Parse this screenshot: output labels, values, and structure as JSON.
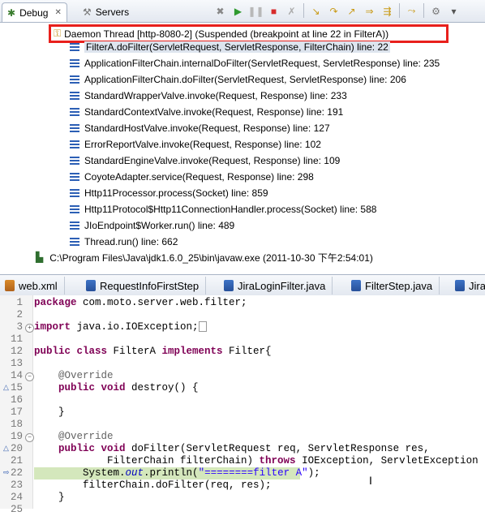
{
  "debug_view": {
    "tabs": [
      {
        "label": "Debug",
        "close": "✕"
      },
      {
        "label": "Servers"
      }
    ],
    "toolbar_icons": [
      "remove-launch-icon",
      "resume-icon",
      "suspend-icon",
      "terminate-icon",
      "disconnect-icon",
      "step-into-icon",
      "step-over-icon",
      "step-return-icon",
      "drop-to-frame-icon",
      "use-step-filters-icon",
      "view-menu-icon"
    ],
    "thread": "Daemon Thread [http-8080-2] (Suspended (breakpoint at line 22 in FilterA))",
    "frames": [
      "FilterA.doFilter(ServletRequest, ServletResponse, FilterChain) line: 22",
      "ApplicationFilterChain.internalDoFilter(ServletRequest, ServletResponse) line: 235",
      "ApplicationFilterChain.doFilter(ServletRequest, ServletResponse) line: 206",
      "StandardWrapperValve.invoke(Request, Response) line: 233",
      "StandardContextValve.invoke(Request, Response) line: 191",
      "StandardHostValve.invoke(Request, Response) line: 127",
      "ErrorReportValve.invoke(Request, Response) line: 102",
      "StandardEngineValve.invoke(Request, Response) line: 109",
      "CoyoteAdapter.service(Request, Response) line: 298",
      "Http11Processor.process(Socket) line: 859",
      "Http11Protocol$Http11ConnectionHandler.process(Socket) line: 588",
      "JIoEndpoint$Worker.run() line: 489",
      "Thread.run() line: 662"
    ],
    "process": "C:\\Program Files\\Java\\jdk1.6.0_25\\bin\\javaw.exe (2011-10-30 下午2:54:01)"
  },
  "editor": {
    "tabs": [
      {
        "label": "web.xml",
        "type": "xml"
      },
      {
        "label": "RequestInfoFirstStep",
        "type": "java"
      },
      {
        "label": "JiraLoginFilter.java",
        "type": "java"
      },
      {
        "label": "FilterStep.java",
        "type": "java"
      },
      {
        "label": "Jira",
        "type": "java"
      }
    ],
    "lines": [
      {
        "n": "1",
        "text": "package com.moto.server.web.filter;"
      },
      {
        "n": "2",
        "text": ""
      },
      {
        "n": "3",
        "text": "import java.io.IOException;"
      },
      {
        "n": "11",
        "text": ""
      },
      {
        "n": "12",
        "text": "public class FilterA implements Filter{"
      },
      {
        "n": "13",
        "text": ""
      },
      {
        "n": "14",
        "text": "    @Override"
      },
      {
        "n": "15",
        "text": "    public void destroy() {"
      },
      {
        "n": "16",
        "text": ""
      },
      {
        "n": "17",
        "text": "    }"
      },
      {
        "n": "18",
        "text": ""
      },
      {
        "n": "19",
        "text": "    @Override"
      },
      {
        "n": "20",
        "text": "    public void doFilter(ServletRequest req, ServletResponse res,"
      },
      {
        "n": "21",
        "text": "            FilterChain filterChain) throws IOException, ServletException {"
      },
      {
        "n": "22",
        "text": "        System.out.println(\"========filter A\");"
      },
      {
        "n": "23",
        "text": "        filterChain.doFilter(req, res);"
      },
      {
        "n": "24",
        "text": "    }"
      },
      {
        "n": "25",
        "text": ""
      }
    ]
  }
}
